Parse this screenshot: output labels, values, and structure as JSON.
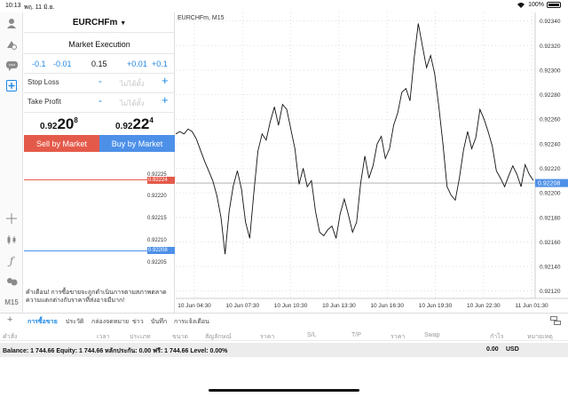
{
  "status": {
    "time": "10:13",
    "date": "พฤ. 11 มิ.ย.",
    "battery": "100%"
  },
  "toolbar": {
    "timeframe": "M15"
  },
  "order": {
    "symbol": "EURCHFm",
    "execution": "Market Execution",
    "lot_steps": [
      "-0.1",
      "-0.01",
      "0.15",
      "+0.01",
      "+0.1"
    ],
    "stop_loss_label": "Stop Loss",
    "take_profit_label": "Take Profit",
    "minus": "-",
    "plus": "+",
    "not_set": "ไม่ได้ตั้ง",
    "bid": {
      "prefix": "0.92",
      "big": "20",
      "sup": "8"
    },
    "ask": {
      "prefix": "0.92",
      "big": "22",
      "sup": "4"
    },
    "sell_label": "Sell by Market",
    "buy_label": "Buy by Market",
    "mini_labels": [
      "0.92225",
      "0.92220",
      "0.92215",
      "0.92210",
      "0.92205"
    ],
    "ask_tag": "0.92224",
    "bid_tag": "0.92208",
    "warning": "คำเตือน! การซื้อขายจะถูกดำเนินการตามสภาพตลาด ความแตกต่างกับราคาที่ส่งอาจมีมาก!",
    "colors": {
      "sell": "#e45a4a",
      "buy": "#4d90e8",
      "ask_line": "#e45a4a",
      "bid_line": "#4d90e8"
    }
  },
  "chart_data": {
    "type": "line",
    "title": "EURCHFm, M15",
    "x_ticks": [
      "10 Jun 04:30",
      "10 Jun 07:30",
      "10 Jun 10:30",
      "10 Jun 13:30",
      "10 Jun 16:30",
      "10 Jun 19:30",
      "10 Jun 22:30",
      "11 Jun 01:30"
    ],
    "y_ticks": [
      "0.92340",
      "0.92320",
      "0.92300",
      "0.92280",
      "0.92260",
      "0.92240",
      "0.92220",
      "0.92200",
      "0.92180",
      "0.92160",
      "0.92140",
      "0.92120"
    ],
    "ylim": [
      0.92114,
      0.92347
    ],
    "current_price": "0.92208",
    "values": [
      0.92248,
      0.9225,
      0.92248,
      0.92252,
      0.9225,
      0.92244,
      0.92235,
      0.92226,
      0.92218,
      0.9221,
      0.92198,
      0.9218,
      0.9215,
      0.92185,
      0.92206,
      0.92218,
      0.92203,
      0.92176,
      0.92163,
      0.922,
      0.92234,
      0.92248,
      0.92243,
      0.92258,
      0.9227,
      0.92255,
      0.92272,
      0.92268,
      0.92252,
      0.92236,
      0.92207,
      0.9222,
      0.92205,
      0.9221,
      0.92185,
      0.92168,
      0.92165,
      0.9217,
      0.92173,
      0.92163,
      0.92183,
      0.92195,
      0.92182,
      0.92168,
      0.92176,
      0.92208,
      0.9223,
      0.92212,
      0.92222,
      0.9224,
      0.92246,
      0.92228,
      0.92236,
      0.92255,
      0.92265,
      0.92282,
      0.92285,
      0.92275,
      0.9231,
      0.92338,
      0.9232,
      0.92302,
      0.92312,
      0.92297,
      0.9227,
      0.9224,
      0.92205,
      0.92198,
      0.92194,
      0.92212,
      0.92235,
      0.9225,
      0.92236,
      0.92245,
      0.92268,
      0.9226,
      0.9225,
      0.92238,
      0.92218,
      0.92212,
      0.92205,
      0.92214,
      0.92222,
      0.92215,
      0.92205,
      0.92223,
      0.92215,
      0.9221
    ]
  },
  "terminal": {
    "tabs": [
      "การซื้อขาย",
      "ประวัติ",
      "กล่องจดหมาย",
      "ข่าว",
      "บันทึก",
      "การแจ้งเตือน"
    ],
    "columns": [
      "คำสั่ง",
      "เวลา",
      "ประเภท",
      "ขนาด",
      "สัญลักษณ์",
      "ราคา",
      "S/L",
      "T/P",
      "ราคา",
      "Swap",
      "กำไร",
      "หมายเหตุ"
    ],
    "balance": "Balance: 1 744.66 Equity: 1 744.66 หลักประกัน: 0.00 ฟรี: 1 744.66 Level: 0.00%",
    "profit": "0.00",
    "currency": "USD"
  }
}
